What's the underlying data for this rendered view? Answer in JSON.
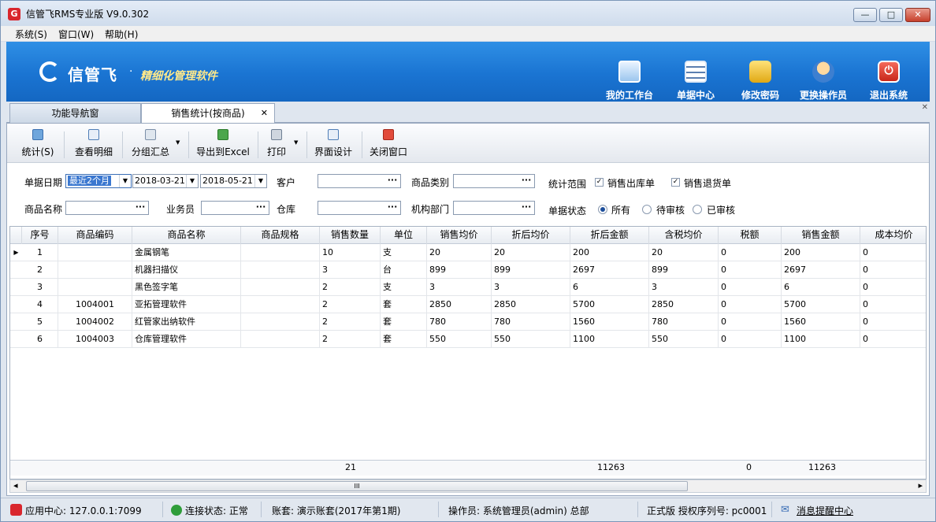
{
  "window": {
    "title": "信管飞RMS专业版 V9.0.302",
    "min": "—",
    "max": "□",
    "close": "✕"
  },
  "menu": [
    {
      "label": "系统(S)"
    },
    {
      "label": "窗口(W)"
    },
    {
      "label": "帮助(H)"
    }
  ],
  "banner": {
    "logo": "信管飞",
    "dot": "·",
    "slogan": "精细化管理软件",
    "buttons": [
      {
        "label": "我的工作台",
        "icon": "monitor-icon"
      },
      {
        "label": "单据中心",
        "icon": "document-list-icon"
      },
      {
        "label": "修改密码",
        "icon": "lock-icon"
      },
      {
        "label": "更换操作员",
        "icon": "user-icon"
      },
      {
        "label": "退出系统",
        "icon": "power-icon"
      }
    ]
  },
  "tabs": [
    {
      "label": "功能导航窗"
    },
    {
      "label": "销售统计(按商品)",
      "close": "✕"
    }
  ],
  "pane_close": "✕",
  "toolbar": [
    {
      "label": "统计(S)",
      "icon": "search-icon"
    },
    {
      "label": "查看明细",
      "icon": "detail-icon"
    },
    {
      "label": "分组汇总",
      "icon": "group-icon"
    },
    {
      "label": "导出到Excel",
      "icon": "excel-icon"
    },
    {
      "label": "打印",
      "icon": "print-icon"
    },
    {
      "label": "界面设计",
      "icon": "layout-icon"
    },
    {
      "label": "关闭窗口",
      "icon": "close-window-icon"
    }
  ],
  "filters": {
    "date_label": "单据日期",
    "date_range": "最近2个月",
    "date_from": "2018-03-21",
    "date_to": "2018-05-21",
    "customer_label": "客户",
    "customer_value": "",
    "category_label": "商品类别",
    "category_value": "",
    "scope_label": "统计范围",
    "scope_sales_out": "销售出库单",
    "scope_sales_return": "销售退货单",
    "product_label": "商品名称",
    "product_value": "",
    "salesman_label": "业务员",
    "salesman_value": "",
    "warehouse_label": "仓库",
    "warehouse_value": "",
    "dept_label": "机构部门",
    "dept_value": "",
    "status_label": "单据状态",
    "status_all": "所有",
    "status_pending": "待审核",
    "status_approved": "已审核",
    "ellipsis": "···",
    "dd_arrow": "▼"
  },
  "table": {
    "columns": [
      "序号",
      "商品编码",
      "商品名称",
      "商品规格",
      "销售数量",
      "单位",
      "销售均价",
      "折后均价",
      "折后金额",
      "含税均价",
      "税额",
      "销售金额",
      "成本均价"
    ],
    "rows": [
      [
        "1",
        "",
        "金属钢笔",
        "",
        "10",
        "支",
        "20",
        "20",
        "200",
        "20",
        "0",
        "200",
        "0"
      ],
      [
        "2",
        "",
        "机器扫描仪",
        "",
        "3",
        "台",
        "899",
        "899",
        "2697",
        "899",
        "0",
        "2697",
        "0"
      ],
      [
        "3",
        "",
        "黑色签字笔",
        "",
        "2",
        "支",
        "3",
        "3",
        "6",
        "3",
        "0",
        "6",
        "0"
      ],
      [
        "4",
        "1004001",
        "亚拓管理软件",
        "",
        "2",
        "套",
        "2850",
        "2850",
        "5700",
        "2850",
        "0",
        "5700",
        "0"
      ],
      [
        "5",
        "1004002",
        "红管家出纳软件",
        "",
        "2",
        "套",
        "780",
        "780",
        "1560",
        "780",
        "0",
        "1560",
        "0"
      ],
      [
        "6",
        "1004003",
        "仓库管理软件",
        "",
        "2",
        "套",
        "550",
        "550",
        "1100",
        "550",
        "0",
        "1100",
        "0"
      ]
    ],
    "totals": {
      "qty": "21",
      "disc_amount": "11263",
      "tax": "0",
      "sales_amount": "11263"
    },
    "current_row_marker": "▶"
  },
  "scrollbar": {
    "left": "◂",
    "right": "▸",
    "grip": "III"
  },
  "status": {
    "app_center": "应用中心: 127.0.0.1:7099",
    "connection": "连接状态: 正常",
    "account": "账套: 演示账套(2017年第1期)",
    "operator": "操作员: 系统管理员(admin) 总部",
    "license": "正式版 授权序列号: pc0001",
    "messages": "消息提醒中心"
  },
  "colors": {
    "banner": "#1a74d2",
    "slogan": "#ffe98a",
    "title_close": "#c7402c"
  }
}
